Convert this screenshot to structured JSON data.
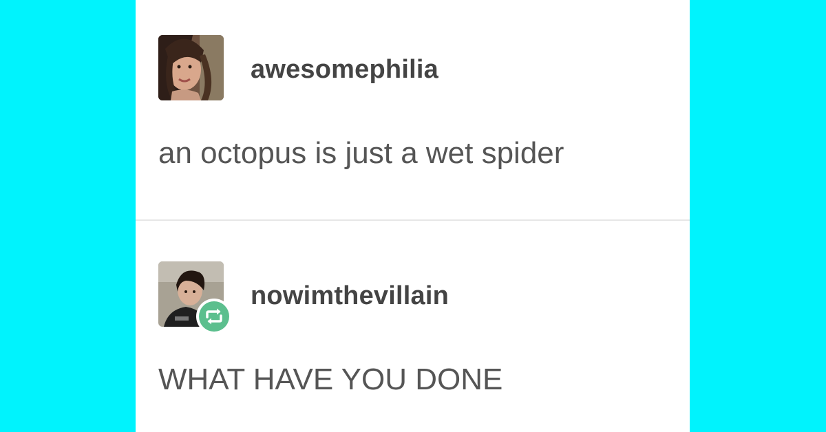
{
  "theme": {
    "background": "#00f3fd",
    "card": "#ffffff",
    "username_color": "#444444",
    "text_color": "#555555",
    "reblog_color": "#5cbf8e"
  },
  "posts": [
    {
      "username": "awesomephilia",
      "text": "an octopus is just a wet spider",
      "avatar": "user-avatar-photo"
    },
    {
      "username": "nowimthevillain",
      "text": "WHAT HAVE YOU DONE",
      "avatar": "user-avatar-photo",
      "badge": "reblog-icon"
    }
  ]
}
